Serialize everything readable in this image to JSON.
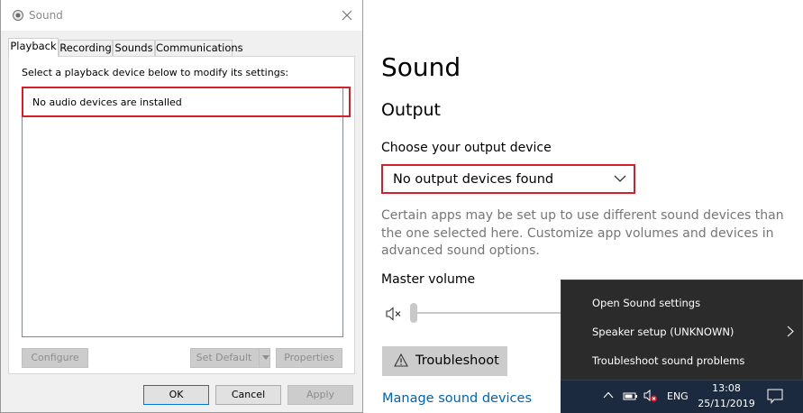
{
  "dialog": {
    "title": "Sound",
    "tabs": [
      {
        "label": "Playback",
        "active": true
      },
      {
        "label": "Recording",
        "active": false
      },
      {
        "label": "Sounds",
        "active": false
      },
      {
        "label": "Communications",
        "active": false
      }
    ],
    "instruction": "Select a playback device below to modify its settings:",
    "no_devices_text": "No audio devices are installed",
    "buttons": {
      "configure": "Configure",
      "set_default": "Set Default",
      "properties": "Properties",
      "ok": "OK",
      "cancel": "Cancel",
      "apply": "Apply"
    }
  },
  "settings": {
    "title": "Sound",
    "output_heading": "Output",
    "choose_label": "Choose your output device",
    "output_device_value": "No output devices found",
    "note": "Certain apps may be set up to use different sound devices than the one selected here. Customize app volumes and devices in advanced sound options.",
    "master_volume_label": "Master volume",
    "master_volume_level": 0,
    "troubleshoot_label": "Troubleshoot",
    "manage_link": "Manage sound devices"
  },
  "context_menu": {
    "items": [
      "Open Sound settings",
      "Speaker setup (UNKNOWN)",
      "Troubleshoot sound problems"
    ]
  },
  "taskbar": {
    "language": "ENG",
    "time": "13:08",
    "date": "25/11/2019"
  },
  "colors": {
    "highlight": "#d4202c",
    "link": "#0063b1",
    "taskbar": "#1b2a3e",
    "menu_bg": "#2b2b2b"
  },
  "icons": [
    "speaker-icon",
    "close-icon",
    "chevron-down-icon",
    "mute-icon",
    "warning-icon",
    "chevron-right-icon",
    "chevron-up-icon",
    "battery-icon",
    "volume-muted-icon",
    "notification-icon"
  ]
}
